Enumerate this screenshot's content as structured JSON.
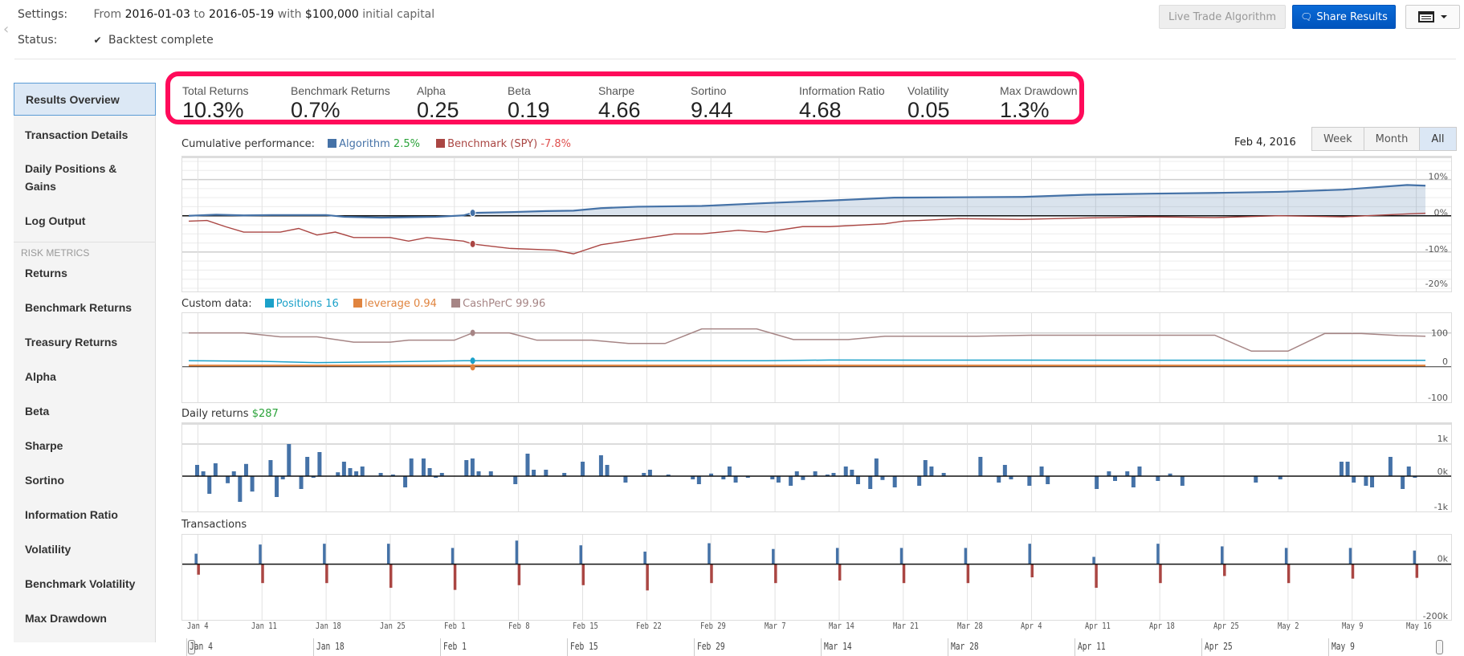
{
  "header": {
    "settings_label": "Settings:",
    "settings_from": "From",
    "start_date": "2016-01-03",
    "settings_to": "to",
    "end_date": "2016-05-19",
    "settings_with": "with",
    "capital": "$100,000",
    "settings_suffix": "initial capital",
    "status_label": "Status:",
    "status_text": "Backtest complete",
    "buttons": {
      "live_trade": "Live Trade Algorithm",
      "share": "Share Results"
    }
  },
  "sidebar": {
    "items": [
      {
        "label": "Results Overview",
        "active": true
      },
      {
        "label": "Transaction Details"
      },
      {
        "label": "Daily Positions & Gains"
      },
      {
        "label": "Log Output"
      }
    ],
    "section_label": "RISK METRICS",
    "risk_items": [
      {
        "label": "Returns"
      },
      {
        "label": "Benchmark Returns"
      },
      {
        "label": "Treasury Returns"
      },
      {
        "label": "Alpha"
      },
      {
        "label": "Beta"
      },
      {
        "label": "Sharpe"
      },
      {
        "label": "Sortino"
      },
      {
        "label": "Information Ratio"
      },
      {
        "label": "Volatility"
      },
      {
        "label": "Benchmark Volatility"
      },
      {
        "label": "Max Drawdown"
      }
    ]
  },
  "metrics": [
    {
      "label": "Total Returns",
      "value": "10.3%"
    },
    {
      "label": "Benchmark Returns",
      "value": "0.7%"
    },
    {
      "label": "Alpha",
      "value": "0.25"
    },
    {
      "label": "Beta",
      "value": "0.19"
    },
    {
      "label": "Sharpe",
      "value": "4.66"
    },
    {
      "label": "Sortino",
      "value": "9.44"
    },
    {
      "label": "Information Ratio",
      "value": "4.68"
    },
    {
      "label": "Volatility",
      "value": "0.05"
    },
    {
      "label": "Max Drawdown",
      "value": "1.3%"
    }
  ],
  "controls": {
    "date_readout": "Feb 4, 2016",
    "ranges": [
      {
        "label": "Week"
      },
      {
        "label": "Month"
      },
      {
        "label": "All",
        "active": true
      }
    ]
  },
  "colors": {
    "algorithm": "#4572a7",
    "benchmark": "#aa4643",
    "positions": "#1ba1c9",
    "leverage": "#e0843f",
    "cashperc": "#a68585",
    "highlight": "#ff0a5a",
    "share_button": "#0a6ad6"
  },
  "chart_data": [
    {
      "type": "line",
      "title": "Cumulative performance:",
      "legend": [
        {
          "name": "Algorithm",
          "value_text": "2.5%"
        },
        {
          "name": "Benchmark (SPY)",
          "value_text": "-7.8%"
        }
      ],
      "y_ticks": [
        "10%",
        "0%",
        "-10%",
        "-20%"
      ],
      "ylim": [
        -20,
        15
      ],
      "x_range_days": [
        0,
        135
      ],
      "highlight_day": 31,
      "series": [
        {
          "name": "Algorithm",
          "points": [
            [
              0,
              0
            ],
            [
              3,
              0.3
            ],
            [
              6,
              0.1
            ],
            [
              9,
              0.2
            ],
            [
              15,
              0.2
            ],
            [
              17,
              -0.3
            ],
            [
              21,
              -0.5
            ],
            [
              27,
              -0.3
            ],
            [
              30,
              0.1
            ],
            [
              31,
              0.8
            ],
            [
              35,
              1
            ],
            [
              39,
              1.3
            ],
            [
              42,
              1.4
            ],
            [
              45,
              2.1
            ],
            [
              49,
              2.5
            ],
            [
              56,
              2.7
            ],
            [
              63,
              3.5
            ],
            [
              70,
              4.2
            ],
            [
              77,
              5
            ],
            [
              84,
              5.1
            ],
            [
              91,
              5.2
            ],
            [
              98,
              5.8
            ],
            [
              105,
              6.1
            ],
            [
              112,
              6.3
            ],
            [
              119,
              6.6
            ],
            [
              126,
              7.2
            ],
            [
              133,
              8.5
            ],
            [
              135,
              8.3
            ]
          ]
        },
        {
          "name": "Benchmark (SPY)",
          "points": [
            [
              0,
              -1.5
            ],
            [
              2,
              -1.3
            ],
            [
              4,
              -3
            ],
            [
              6,
              -4.5
            ],
            [
              10,
              -4.5
            ],
            [
              12,
              -3.5
            ],
            [
              14,
              -5.3
            ],
            [
              16,
              -4.5
            ],
            [
              18,
              -6
            ],
            [
              22,
              -6
            ],
            [
              24,
              -7
            ],
            [
              26,
              -6
            ],
            [
              30,
              -7
            ],
            [
              31,
              -7.8
            ],
            [
              35,
              -9
            ],
            [
              40,
              -9.5
            ],
            [
              42,
              -10.5
            ],
            [
              45,
              -8
            ],
            [
              49,
              -6.5
            ],
            [
              53,
              -5
            ],
            [
              56,
              -5
            ],
            [
              60,
              -4
            ],
            [
              63,
              -4.5
            ],
            [
              67,
              -3
            ],
            [
              70,
              -3
            ],
            [
              76,
              -2.2
            ],
            [
              78,
              -1.5
            ],
            [
              84,
              -0.8
            ],
            [
              91,
              -1
            ],
            [
              98,
              -0.6
            ],
            [
              105,
              -0.3
            ],
            [
              112,
              -0.5
            ],
            [
              119,
              0
            ],
            [
              126,
              -0.3
            ],
            [
              133,
              0.5
            ],
            [
              135,
              0.7
            ]
          ]
        }
      ]
    },
    {
      "type": "line",
      "title": "Custom data:",
      "legend": [
        {
          "name": "Positions",
          "value_text": "16"
        },
        {
          "name": "leverage",
          "value_text": "0.94"
        },
        {
          "name": "CashPerC",
          "value_text": "99.96"
        }
      ],
      "y_ticks": [
        "100",
        "0",
        "-100"
      ],
      "ylim": [
        -100,
        150
      ],
      "series": [
        {
          "name": "CashPerC",
          "points": [
            [
              0,
              100
            ],
            [
              6,
              100
            ],
            [
              10,
              88
            ],
            [
              14,
              88
            ],
            [
              18,
              72
            ],
            [
              22,
              72
            ],
            [
              24,
              78
            ],
            [
              29,
              78
            ],
            [
              31,
              100
            ],
            [
              35,
              100
            ],
            [
              38,
              78
            ],
            [
              44,
              78
            ],
            [
              48,
              68
            ],
            [
              52,
              68
            ],
            [
              56,
              112
            ],
            [
              62,
              112
            ],
            [
              66,
              80
            ],
            [
              72,
              80
            ],
            [
              76,
              90
            ],
            [
              86,
              90
            ],
            [
              92,
              93
            ],
            [
              112,
              93
            ],
            [
              116,
              45
            ],
            [
              120,
              45
            ],
            [
              124,
              98
            ],
            [
              128,
              98
            ],
            [
              132,
              92
            ],
            [
              135,
              90
            ]
          ]
        },
        {
          "name": "Positions",
          "points": [
            [
              0,
              16
            ],
            [
              8,
              14
            ],
            [
              14,
              10
            ],
            [
              20,
              12
            ],
            [
              30,
              16
            ],
            [
              63,
              16
            ],
            [
              70,
              18
            ],
            [
              135,
              17
            ]
          ]
        },
        {
          "name": "leverage",
          "points": [
            [
              0,
              0.94
            ],
            [
              135,
              0.94
            ]
          ]
        }
      ]
    },
    {
      "type": "bar",
      "title": "Daily returns",
      "value_text": "$287",
      "y_ticks": [
        "1k",
        "0k",
        "-1k"
      ],
      "ylim": [
        -1000,
        1500
      ],
      "values": [
        350,
        150,
        -550,
        400,
        0,
        -220,
        150,
        -800,
        380,
        -480,
        0,
        0,
        500,
        -650,
        -100,
        1000,
        0,
        -400,
        600,
        -50,
        750,
        0,
        0,
        120,
        450,
        250,
        150,
        300,
        0,
        0,
        100,
        0,
        50,
        0,
        -350,
        550,
        0,
        550,
        250,
        -50,
        100,
        0,
        0,
        0,
        500,
        550,
        150,
        0,
        150,
        0,
        0,
        0,
        -250,
        0,
        700,
        200,
        0,
        200,
        0,
        0,
        100,
        0,
        0,
        450,
        0,
        0,
        650,
        350,
        0,
        0,
        -200,
        0,
        0,
        100,
        200,
        0,
        0,
        50,
        0,
        0,
        0,
        -100,
        -250,
        0,
        80,
        0,
        -100,
        300,
        -200,
        0,
        -50,
        0,
        0,
        0,
        -100,
        -200,
        0,
        -300,
        150,
        -120,
        0,
        150,
        0,
        50,
        100,
        0,
        300,
        200,
        -250,
        0,
        -400,
        550,
        -120,
        0,
        -350,
        0,
        0,
        0,
        -300,
        500,
        300,
        0,
        100,
        0,
        0,
        0,
        0,
        0,
        600,
        0,
        0,
        -200,
        350,
        -100,
        0,
        0,
        -300,
        0,
        300,
        -250,
        0,
        0,
        0,
        0,
        0,
        0,
        0,
        -400,
        0,
        150,
        -150,
        0,
        150,
        -350,
        300,
        0,
        0,
        -150,
        0,
        80,
        0,
        -300,
        0,
        0,
        0,
        0,
        0,
        0,
        0,
        0,
        0,
        0,
        0,
        -200,
        0,
        0,
        0,
        -100,
        0,
        0,
        0,
        0,
        0,
        0,
        0,
        0,
        0,
        450,
        450,
        -200,
        0,
        -300,
        -350,
        0,
        0,
        600,
        0,
        -400,
        300,
        -50
      ]
    },
    {
      "type": "bar",
      "title": "Transactions",
      "y_ticks": [
        "0k",
        "-200k"
      ],
      "ylim": [
        -200000,
        100000
      ],
      "x_tick_labels": [
        "Jan 4",
        "Jan 11",
        "Jan 18",
        "Jan 25",
        "Feb 1",
        "Feb 8",
        "Feb 15",
        "Feb 22",
        "Feb 29",
        "Mar 7",
        "Mar 14",
        "Mar 21",
        "Mar 28",
        "Apr 4",
        "Apr 11",
        "Apr 18",
        "Apr 25",
        "May 2",
        "May 9",
        "May 16"
      ],
      "series": [
        {
          "name": "Buys",
          "points": [
            [
              0,
              40000
            ],
            [
              7,
              75000
            ],
            [
              14,
              78000
            ],
            [
              21,
              78000
            ],
            [
              28,
              62000
            ],
            [
              35,
              90000
            ],
            [
              42,
              72000
            ],
            [
              49,
              48000
            ],
            [
              56,
              80000
            ],
            [
              63,
              58000
            ],
            [
              70,
              62000
            ],
            [
              77,
              62000
            ],
            [
              84,
              62000
            ],
            [
              91,
              78000
            ],
            [
              98,
              28000
            ],
            [
              105,
              78000
            ],
            [
              112,
              68000
            ],
            [
              119,
              62000
            ],
            [
              126,
              62000
            ],
            [
              133,
              52000
            ]
          ]
        },
        {
          "name": "Sells",
          "points": [
            [
              0,
              -40000
            ],
            [
              7,
              -72000
            ],
            [
              14,
              -72000
            ],
            [
              21,
              -90000
            ],
            [
              28,
              -98000
            ],
            [
              35,
              -80000
            ],
            [
              42,
              -80000
            ],
            [
              49,
              -100000
            ],
            [
              56,
              -72000
            ],
            [
              63,
              -72000
            ],
            [
              70,
              -62000
            ],
            [
              77,
              -72000
            ],
            [
              84,
              -72000
            ],
            [
              91,
              -50000
            ],
            [
              98,
              -90000
            ],
            [
              105,
              -72000
            ],
            [
              112,
              -45000
            ],
            [
              119,
              -72000
            ],
            [
              126,
              -55000
            ],
            [
              133,
              -52000
            ]
          ]
        }
      ]
    }
  ],
  "navigator": {
    "labels": [
      "Jan 4",
      "Jan 18",
      "Feb 1",
      "Feb 15",
      "Feb 29",
      "Mar 14",
      "Mar 28",
      "Apr 11",
      "Apr 25",
      "May 9"
    ]
  }
}
